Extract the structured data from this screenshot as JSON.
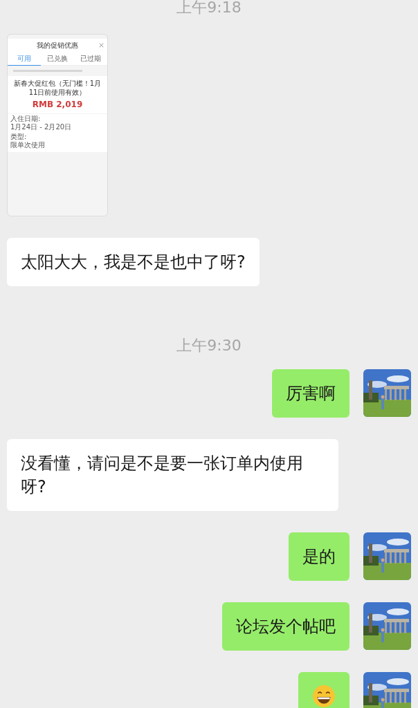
{
  "messages": [
    {
      "kind": "time",
      "text": "上午9:18"
    },
    {
      "outgoing": false,
      "screenshot": {
        "title": "我的促销优惠",
        "tabs": [
          {
            "label": "可用",
            "selected": true
          },
          {
            "label": "已兑换",
            "selected": false
          },
          {
            "label": "已过期",
            "selected": false
          }
        ],
        "promo_title": "新春大促红包（无门槛！1月11日前使用有效）",
        "amount": "RMB 2,019",
        "fields": [
          {
            "label": "入住日期:",
            "value": "1月24日 - 2月20日"
          },
          {
            "label": "类型:",
            "value": "限单次使用"
          }
        ]
      }
    },
    {
      "kind": "text",
      "outgoing": false,
      "text": "太阳大大，我是不是也中了呀?"
    },
    {
      "kind": "time",
      "text": "上午9:30"
    },
    {
      "kind": "text",
      "outgoing": true,
      "text": "厉害啊"
    },
    {
      "kind": "text",
      "outgoing": false,
      "text": "没看懂，请问是不是要一张订单内使用呀?"
    },
    {
      "kind": "text",
      "outgoing": true,
      "text": "是的"
    },
    {
      "kind": "text",
      "outgoing": true,
      "text": "论坛发个帖吧"
    },
    {
      "kind": "emoji",
      "outgoing": true
    }
  ]
}
